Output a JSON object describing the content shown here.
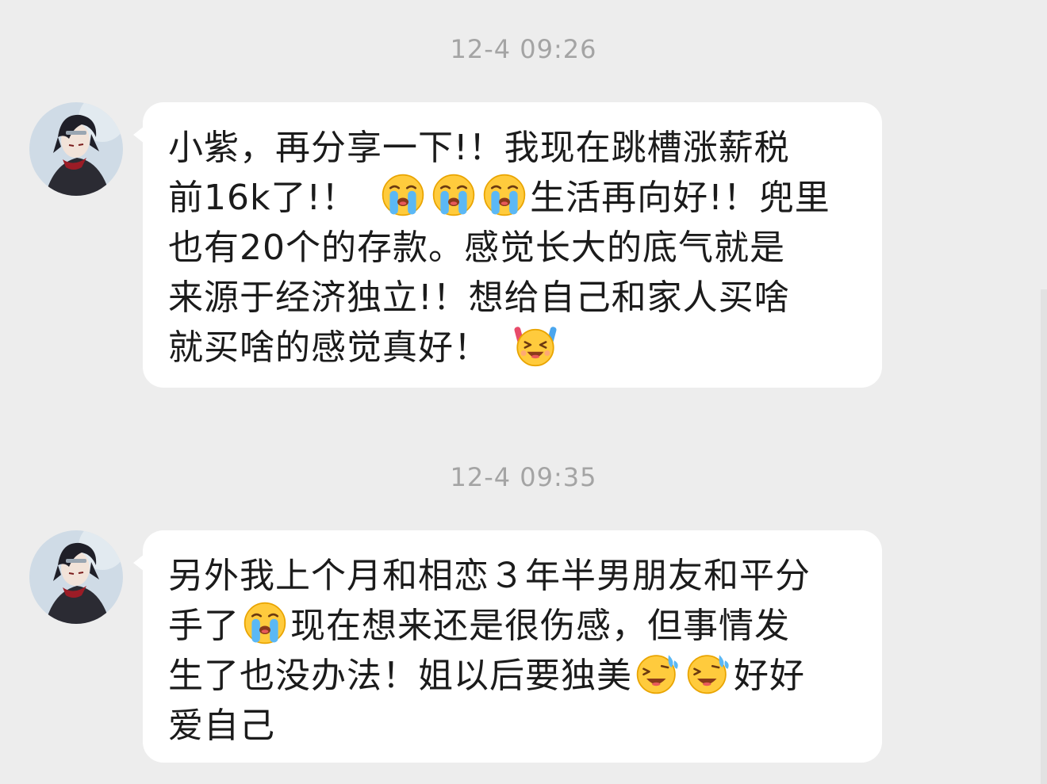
{
  "messages": [
    {
      "timestamp": "12-4 09:26",
      "lines": {
        "l1": "小紫，再分享一下!！我现在跳槽涨薪税",
        "l2a": "前16k了!！",
        "l2b": "生活再向好!！兜里",
        "l3": "也有20个的存款。感觉长大的底气就是",
        "l4": "来源于经济独立!！想给自己和家人买啥",
        "l5": "就买啥的感觉真好！"
      },
      "emojis": [
        "loudly-crying-icon",
        "loudly-crying-icon",
        "loudly-crying-icon",
        "party-cheer-icon"
      ]
    },
    {
      "timestamp": "12-4 09:35",
      "lines": {
        "l1": "另外我上个月和相恋３年半男朋友和平分",
        "l2a": "手了",
        "l2b": "现在想来还是很伤感，但事情发",
        "l3a": "生了也没办法！姐以后要独美",
        "l3b": "好好",
        "l4": "爱自己"
      },
      "emojis": [
        "loudly-crying-icon",
        "laugh-cry-icon",
        "laugh-cry-icon"
      ]
    }
  ],
  "colors": {
    "background": "#ededed",
    "bubble": "#ffffff",
    "timestamp": "#a4a4a4",
    "text": "#1b1b1b"
  }
}
